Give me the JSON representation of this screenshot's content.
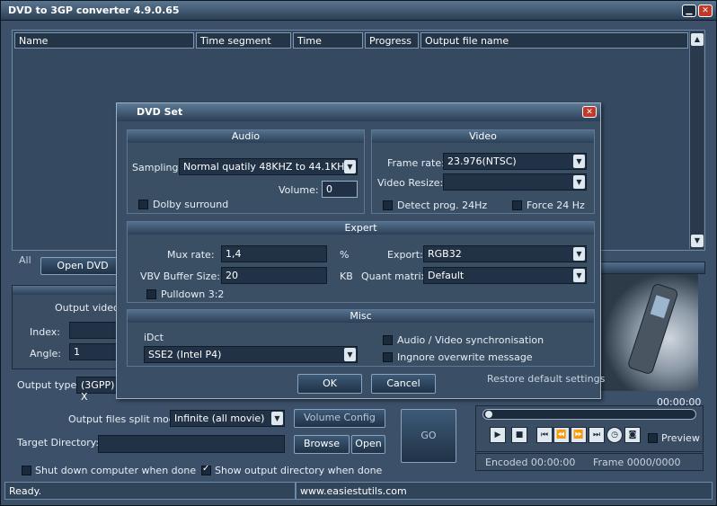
{
  "window": {
    "title": "DVD to 3GP converter 4.9.0.65"
  },
  "list": {
    "columns": [
      "Name",
      "Time segment",
      "Time",
      "Progress",
      "Output file name"
    ],
    "filter_label": "All",
    "open_dvd_label": "Open DVD"
  },
  "main_panel": {
    "output_video_label": "Output video s",
    "index_label": "Index:",
    "angle_label": "Angle:",
    "angle_value": "1",
    "output_type_label": "Output type:",
    "output_type_value": "(3GPP) X",
    "split_mode_label": "Output files split mode:",
    "split_mode_value": "Infinite (all movie)",
    "volume_config_label": "Volume Config",
    "target_dir_label": "Target Directory:",
    "target_dir_value": "",
    "browse_label": "Browse",
    "open_label": "Open",
    "go_label": "GO",
    "shutdown_label": "Shut down computer when done",
    "shutdown_checked": false,
    "show_dir_label": "Show output directory when done",
    "show_dir_checked": true
  },
  "player": {
    "time": "00:00:00",
    "preview_label": "Preview",
    "encoded_label": "Encoded 00:00:00",
    "frame_label": "Frame 0000/0000"
  },
  "status": {
    "left": "Ready.",
    "right": "www.easiestutils.com"
  },
  "dialog": {
    "title": "DVD Set",
    "audio": {
      "header": "Audio",
      "sampling_label": "Sampling:",
      "sampling_value": "Normal quatily 48KHZ to 44.1KHZ",
      "volume_label": "Volume:",
      "volume_value": "0",
      "dolby_label": "Dolby surround",
      "dolby_checked": false
    },
    "video": {
      "header": "Video",
      "frame_rate_label": "Frame rate:",
      "frame_rate_value": "23.976(NTSC)",
      "resize_label": "Video Resize:",
      "resize_value": "",
      "detect_label": "Detect prog. 24Hz",
      "force_label": "Force 24 Hz"
    },
    "expert": {
      "header": "Expert",
      "mux_label": "Mux  rate:",
      "mux_value": "1,4",
      "mux_unit": "%",
      "vbv_label": "VBV Buffer Size:",
      "vbv_value": "20",
      "vbv_unit": "KB",
      "export_label": "Export:",
      "export_value": "RGB32",
      "quant_label": "Quant matrix:",
      "quant_value": "Default",
      "pulldown_label": "Pulldown 3:2"
    },
    "misc": {
      "header": "Misc",
      "idct_label": "iDct",
      "idct_value": "SSE2 (Intel P4)",
      "av_sync_label": "Audio / Video synchronisation",
      "ignore_label": "Ingnore  overwrite message"
    },
    "restore_label": "Restore default settings",
    "ok_label": "OK",
    "cancel_label": "Cancel"
  }
}
